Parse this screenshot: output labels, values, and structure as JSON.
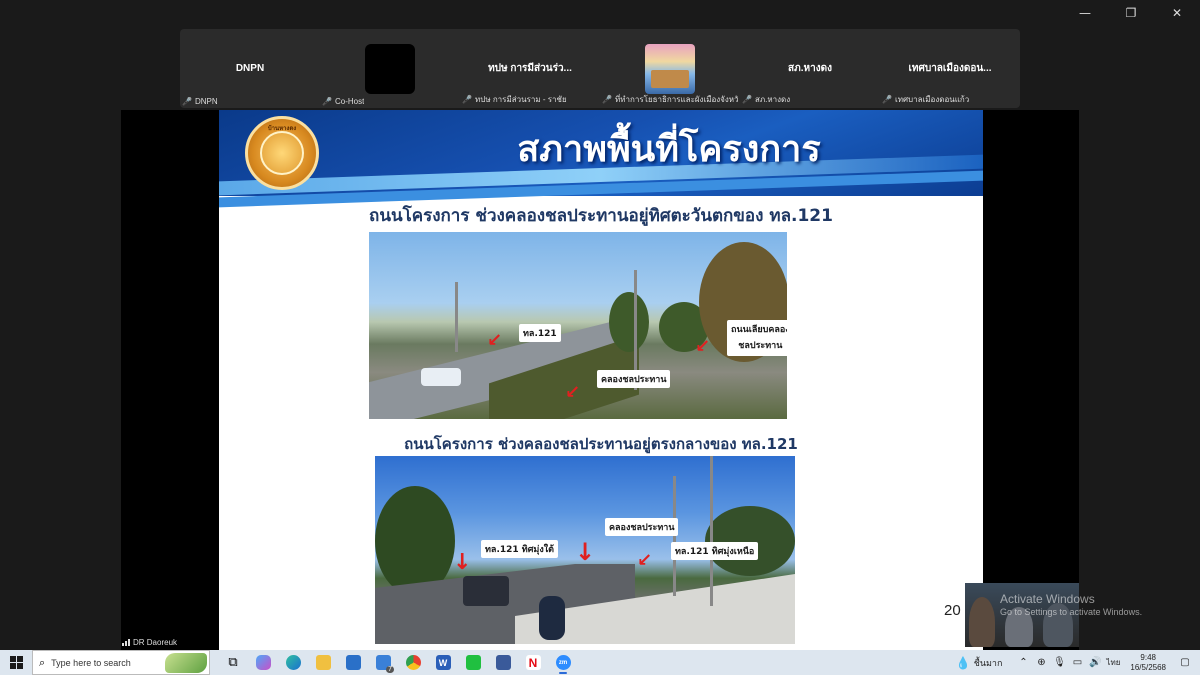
{
  "window": {
    "minimize": "—",
    "restore": "❐",
    "close": "✕"
  },
  "participants": [
    {
      "title": "DNPN",
      "name": "DNPN",
      "thumb": "none"
    },
    {
      "title": "",
      "name": "Co-Host",
      "thumb": "black"
    },
    {
      "title": "ทปษ การมีส่วนร่ว...",
      "name": "ทปษ การมีส่วนราม - ราชัย",
      "thumb": "none"
    },
    {
      "title": "",
      "name": "ที่ทำการโยธาธิการและผังเมืองจังหวัดเชียงใหม่",
      "thumb": "image"
    },
    {
      "title": "สภ.หางดง",
      "name": "สภ.หางดง",
      "thumb": "none"
    },
    {
      "title": "เทศบาลเมืองดอน...",
      "name": "เทศบาลเมืองดอนแก้ว",
      "thumb": "none"
    }
  ],
  "slide": {
    "logo_text": "บ้านหางดง",
    "title": "สภาพพื้นที่โครงการ",
    "section1": "ถนนโครงการ ช่วงคลองชลประทานอยู่ทิศตะวันตกของ ทล.121",
    "section2": "ถนนโครงการ ช่วงคลองชลประทานอยู่ตรงกลางของ ทล.121",
    "photo1_labels": {
      "highway": "ทล.121",
      "canal": "คลองชลประทาน",
      "frontage1": "ถนนเลียบคลอง",
      "frontage2": "ชลประทาน"
    },
    "photo2_labels": {
      "south": "ทล.121 ทิศมุ่งใต้",
      "canal": "คลองชลประทาน",
      "north": "ทล.121 ทิศมุ่งเหนือ"
    },
    "page_number": "20"
  },
  "self_view": {
    "name": "DR Daoreuk"
  },
  "watermark": {
    "line1": "Activate Windows",
    "line2": "Go to Settings to activate Windows."
  },
  "taskbar": {
    "search_placeholder": "Type here to search",
    "apps": [
      "task-view",
      "copilot",
      "edge",
      "file-explorer",
      "store",
      "mail",
      "chrome",
      "word",
      "line",
      "app-photos",
      "netflix",
      "zoom"
    ],
    "mail_badge": "7",
    "weather": "ชื้นมาก",
    "language": "ไทย",
    "time": "9:48",
    "date": "16/5/2568"
  }
}
